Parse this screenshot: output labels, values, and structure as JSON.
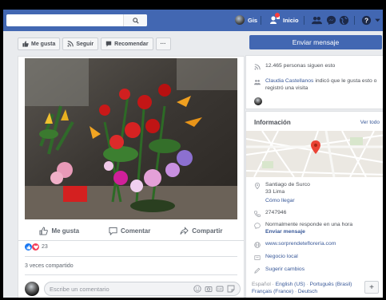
{
  "topbar": {
    "user_name": "Gis",
    "home_label": "Inicio",
    "search_icon": "search-icon"
  },
  "page_actions": {
    "like": "Me gusta",
    "follow": "Seguir",
    "recommend": "Recomendar",
    "more": "···"
  },
  "post": {
    "like": "Me gusta",
    "comment": "Comentar",
    "share": "Compartir",
    "reactions_count": "23",
    "shares": "3 veces compartido",
    "comment_placeholder": "Escribe un comentario"
  },
  "sidebar": {
    "send_message": "Enviar mensaje",
    "followers": "12.465 personas siguen esto",
    "visit_name": "Claudia Castellanos",
    "visit_text": " indicó que le gusta esto o registró una visita",
    "info_title": "Información",
    "see_all": "Ver todo",
    "address_line1": "Santiago de Surco",
    "address_line2": "33 Lima",
    "directions": "Cómo llegar",
    "phone": "2747946",
    "response_text": "Normalmente responde en una hora",
    "send_message_link": "Enviar mensaje",
    "website": "www.sorprendeteflorería.com",
    "category": "Negocio local",
    "suggest_edits": "Sugerir cambios"
  },
  "footer": {
    "lang_current": "Español",
    "lang_1": "English (US)",
    "lang_2": "Português (Brasil)",
    "lang_3": "Français (France)",
    "lang_4": "Deutsch",
    "plus": "+"
  },
  "colors": {
    "brand": "#4267b2",
    "link": "#385898",
    "like_blue": "#1877f2",
    "love_red": "#f33e58",
    "map_pin": "#ea4335"
  }
}
